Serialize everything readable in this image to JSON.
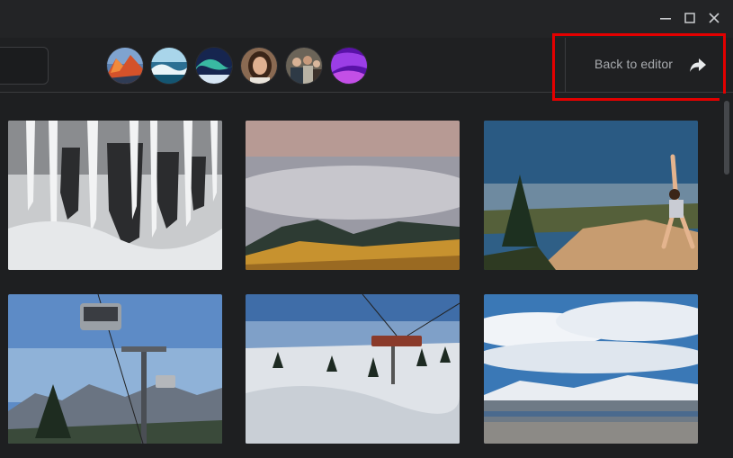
{
  "window": {
    "controls": [
      "minimize-icon",
      "maximize-icon",
      "close-icon"
    ]
  },
  "toolbar": {
    "back_label": "Back to editor",
    "back_icon": "share-arrow-icon",
    "avatars": [
      {
        "name": "avatar-mountain-sunset",
        "icon": "photo"
      },
      {
        "name": "avatar-ocean-wave",
        "icon": "photo"
      },
      {
        "name": "avatar-aurora",
        "icon": "photo"
      },
      {
        "name": "avatar-woman-portrait",
        "icon": "photo"
      },
      {
        "name": "avatar-group-photo",
        "icon": "photo"
      },
      {
        "name": "avatar-purple-abstract",
        "icon": "photo"
      }
    ]
  },
  "gallery": {
    "images": [
      {
        "name": "icicles"
      },
      {
        "name": "cloudy-mountains"
      },
      {
        "name": "yoga-cliff"
      },
      {
        "name": "chairlift-mountains"
      },
      {
        "name": "snowy-slope-chairlift"
      },
      {
        "name": "snowy-valley-view"
      }
    ]
  },
  "colors": {
    "highlight": "#e30000",
    "background": "#1e1f21"
  }
}
